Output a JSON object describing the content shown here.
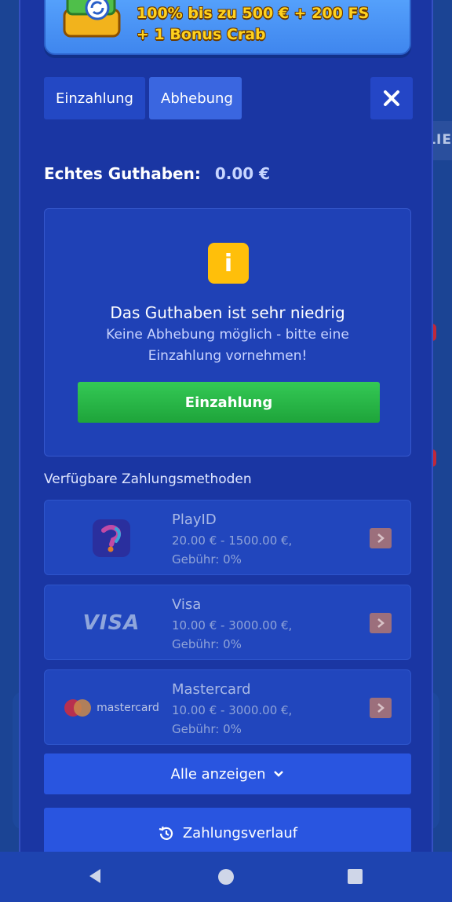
{
  "background": {
    "side_tab_label": "LIE"
  },
  "promo": {
    "line1": "100% bis zu 500 € + 200 FS",
    "line2": "+ 1 Bonus Crab"
  },
  "tabs": [
    {
      "label": "Einzahlung",
      "active": false
    },
    {
      "label": "Abhebung",
      "active": true
    }
  ],
  "balance": {
    "label": "Echtes Guthaben:",
    "value": "0.00 €"
  },
  "notice": {
    "icon": "i",
    "title": "Das Guthaben ist sehr niedrig",
    "text": "Keine Abhebung möglich - bitte eine Einzahlung vornehmen!",
    "button_label": "Einzahlung"
  },
  "methods_heading": "Verfügbare Zahlungsmethoden",
  "methods": [
    {
      "name": "PlayID",
      "range": "20.00 € - 1500.00 €,",
      "fee": "Gebühr: 0%",
      "logo": "playid-logo"
    },
    {
      "name": "Visa",
      "range": "10.00 € - 3000.00 €,",
      "fee": "Gebühr: 0%",
      "logo": "visa-logo",
      "logo_text": "VISA"
    },
    {
      "name": "Mastercard",
      "range": "10.00 € - 3000.00 €,",
      "fee": "Gebühr: 0%",
      "logo": "mastercard-logo",
      "logo_text": "mastercard"
    }
  ],
  "show_all_label": "Alle anzeigen",
  "history_label": "Zahlungsverlauf",
  "colors": {
    "modal_bg": "#1a36a3",
    "accent_green": "#2bb848",
    "accent_blue": "#2955e0",
    "info_yellow": "#ffbf0a",
    "promo_text": "#ffd21e"
  }
}
